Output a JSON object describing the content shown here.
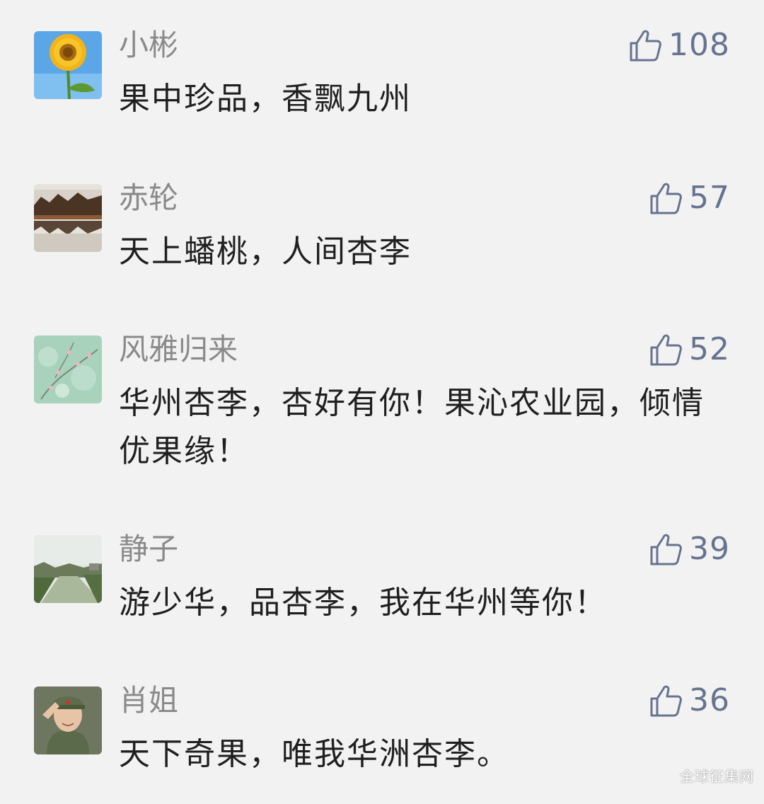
{
  "comments": [
    {
      "user": "小彬",
      "text": "果中珍品，香飘九州",
      "likes": "108",
      "avatar_icon": "sunflower-avatar-icon"
    },
    {
      "user": "赤轮",
      "text": "天上蟠桃，人间杏李",
      "likes": "57",
      "avatar_icon": "lake-landscape-avatar-icon"
    },
    {
      "user": "风雅归来",
      "text": "华州杏李，杏好有你！果沁农业园，倾情优果缘！",
      "likes": "52",
      "avatar_icon": "blossom-avatar-icon"
    },
    {
      "user": "静子",
      "text": "游少华，品杏李，我在华州等你！",
      "likes": "39",
      "avatar_icon": "river-avatar-icon"
    },
    {
      "user": "肖姐",
      "text": "天下奇果，唯我华洲杏李。",
      "likes": "36",
      "avatar_icon": "saluting-woman-avatar-icon"
    }
  ],
  "watermark": "全球征集网",
  "like_icon": "thumbs-up-icon",
  "colors": {
    "background": "#f2f2f2",
    "username": "#8a8a8a",
    "comment_text": "#1f1f1f",
    "like": "#66738f"
  }
}
